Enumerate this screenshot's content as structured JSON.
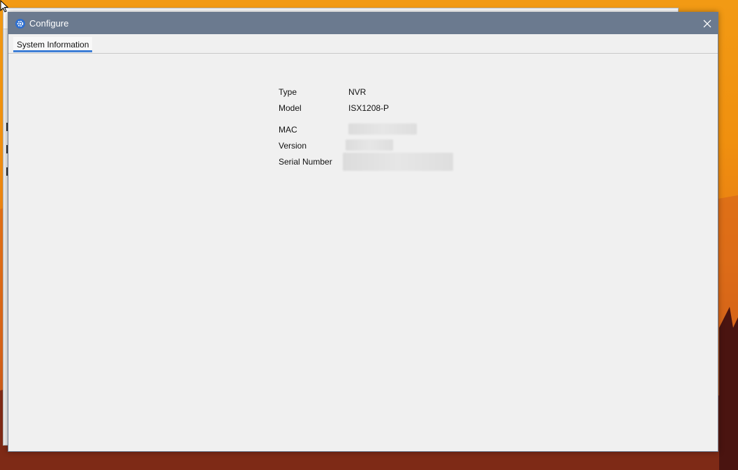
{
  "dialog": {
    "title": "Configure",
    "close_icon": "close-icon",
    "app_icon": "gear-icon"
  },
  "tabs": [
    {
      "label": "System Information",
      "active": true
    }
  ],
  "system_info": {
    "type_label": "Type",
    "type_value": "NVR",
    "model_label": "Model",
    "model_value": "ISX1208-P",
    "mac_label": "MAC",
    "version_label": "Version",
    "serial_label": "Serial Number"
  },
  "colors": {
    "titlebar": "#6b7a8f",
    "tab_accent": "#3e7ed6",
    "dialog_bg": "#f0f0f0"
  }
}
